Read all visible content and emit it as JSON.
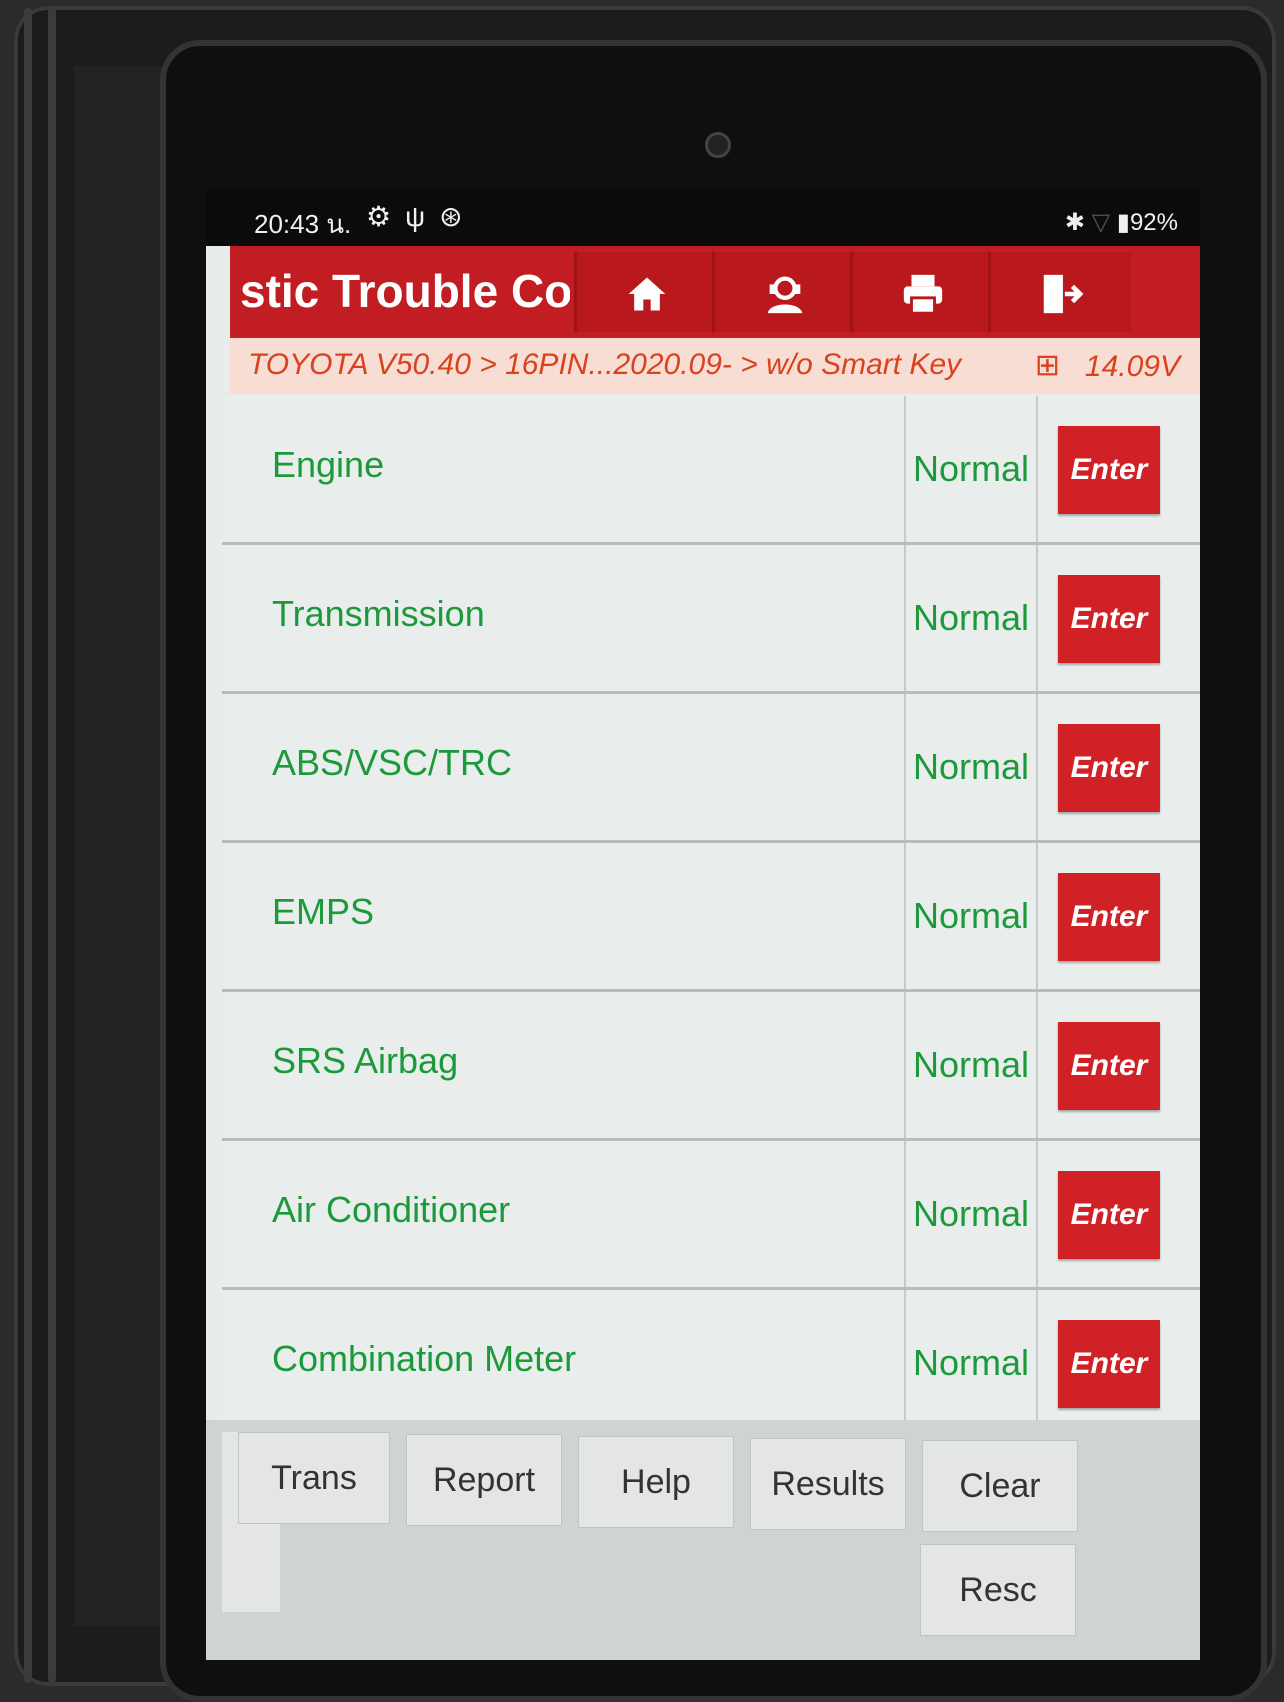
{
  "statusbar": {
    "time": "20:43 น.",
    "left_icons": [
      "gear-icon",
      "stethoscope-icon",
      "bluetooth-circle-icon"
    ],
    "battery": "92%",
    "right_icons": [
      "bluetooth-icon",
      "wifi-icon",
      "battery-icon"
    ]
  },
  "titlebar": {
    "title": "stic Trouble Co",
    "buttons": [
      "home-icon",
      "support-agent-icon",
      "printer-icon",
      "exit-icon"
    ]
  },
  "breadcrumb": {
    "path": "TOYOTA V50.40 > 16PIN...2020.09- > w/o Smart Key",
    "voltage": "14.09V"
  },
  "systems": [
    {
      "name": "Engine",
      "status": "Normal",
      "action": "Enter"
    },
    {
      "name": "Transmission",
      "status": "Normal",
      "action": "Enter"
    },
    {
      "name": "ABS/VSC/TRC",
      "status": "Normal",
      "action": "Enter"
    },
    {
      "name": "EMPS",
      "status": "Normal",
      "action": "Enter"
    },
    {
      "name": "SRS Airbag",
      "status": "Normal",
      "action": "Enter"
    },
    {
      "name": "Air Conditioner",
      "status": "Normal",
      "action": "Enter"
    },
    {
      "name": "Combination Meter",
      "status": "Normal",
      "action": "Enter"
    }
  ],
  "bottom_buttons": {
    "trans": "Trans",
    "report": "Report",
    "help": "Help",
    "results": "Results",
    "clear": "Clear",
    "resc": "Resc"
  },
  "colors": {
    "accent_red": "#c21d23",
    "status_green": "#1c9a3b",
    "breadcrumb_text": "#d9421e"
  }
}
